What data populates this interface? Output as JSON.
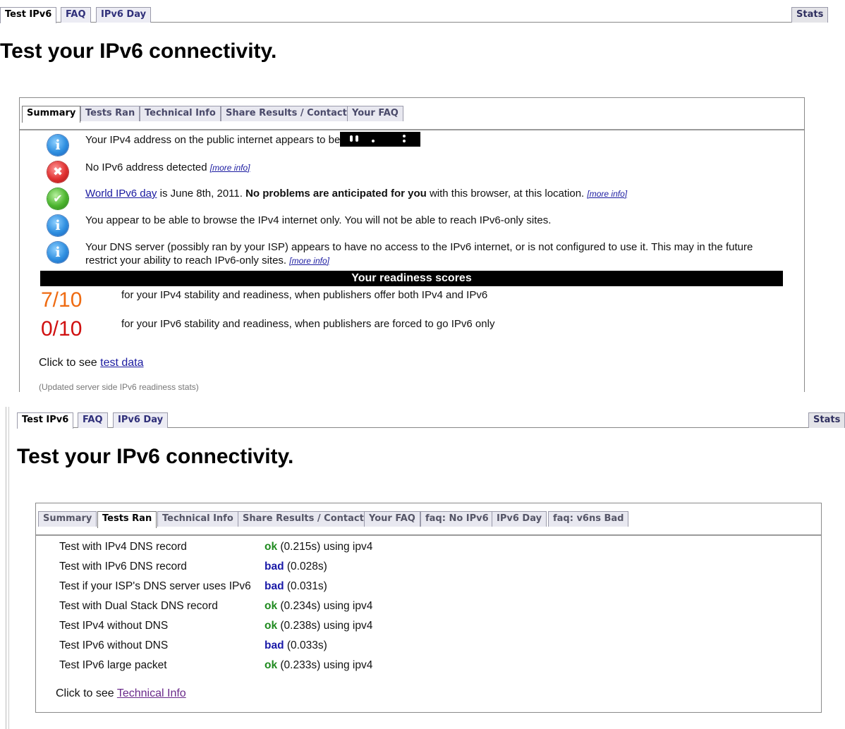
{
  "nav": {
    "tabs": [
      "Test IPv6",
      "FAQ",
      "IPv6 Day"
    ],
    "stats": "Stats"
  },
  "page_title": "Test your IPv6 connectivity.",
  "summary_panel": {
    "tabs": [
      "Summary",
      "Tests Ran",
      "Technical Info",
      "Share Results / Contact",
      "Your FAQ"
    ],
    "messages": {
      "ipv4": "Your IPv4 address on the public internet appears to be",
      "no_ipv6": "No IPv6 address detected",
      "world_day_link": "World IPv6 day",
      "world_day_mid": " is June 8th, 2011. ",
      "world_day_bold": "No problems are anticipated for you",
      "world_day_tail": " with this browser, at this location. ",
      "browse": "You appear to be able to browse the IPv4 internet only. You will not be able to reach IPv6-only sites.",
      "dns": "Your DNS server (possibly ran by your ISP) appears to have no access to the IPv6 internet, or is not configured to use it. This may in the future restrict your ability to reach IPv6-only sites. ",
      "more_info": "[more info]"
    },
    "readiness_title": "Your readiness scores",
    "scores": [
      {
        "value": "7/10",
        "desc": "for your IPv4 stability and readiness, when publishers offer both IPv4 and IPv6",
        "color": "#ef6b12"
      },
      {
        "value": "0/10",
        "desc": "for your IPv6 stability and readiness, when publishers are forced to go IPv6 only",
        "color": "#d01010"
      }
    ],
    "click_prefix": "Click to see ",
    "click_link": "test data",
    "footnote": "(Updated server side IPv6 readiness stats)"
  },
  "tests_panel": {
    "tabs": [
      "Summary",
      "Tests Ran",
      "Technical Info",
      "Share Results / Contact",
      "Your FAQ",
      "faq: No IPv6",
      "IPv6 Day",
      "faq: v6ns Bad"
    ],
    "tests": [
      {
        "label": "Test with IPv4 DNS record",
        "status": "ok",
        "detail": " (0.215s) using ipv4"
      },
      {
        "label": "Test with IPv6 DNS record",
        "status": "bad",
        "detail": " (0.028s)"
      },
      {
        "label": "Test if your ISP's DNS server uses IPv6",
        "status": "bad",
        "detail": " (0.031s)"
      },
      {
        "label": "Test with Dual Stack DNS record",
        "status": "ok",
        "detail": " (0.234s) using ipv4"
      },
      {
        "label": "Test IPv4 without DNS",
        "status": "ok",
        "detail": " (0.238s) using ipv4"
      },
      {
        "label": "Test IPv6 without DNS",
        "status": "bad",
        "detail": " (0.033s)"
      },
      {
        "label": "Test IPv6 large packet",
        "status": "ok",
        "detail": " (0.233s) using ipv4"
      }
    ],
    "click_prefix": "Click to see ",
    "click_link": "Technical Info"
  },
  "colors": {
    "ok": "#1e8a1e",
    "bad": "#1a1aa8",
    "link": "#1a1aa0"
  }
}
